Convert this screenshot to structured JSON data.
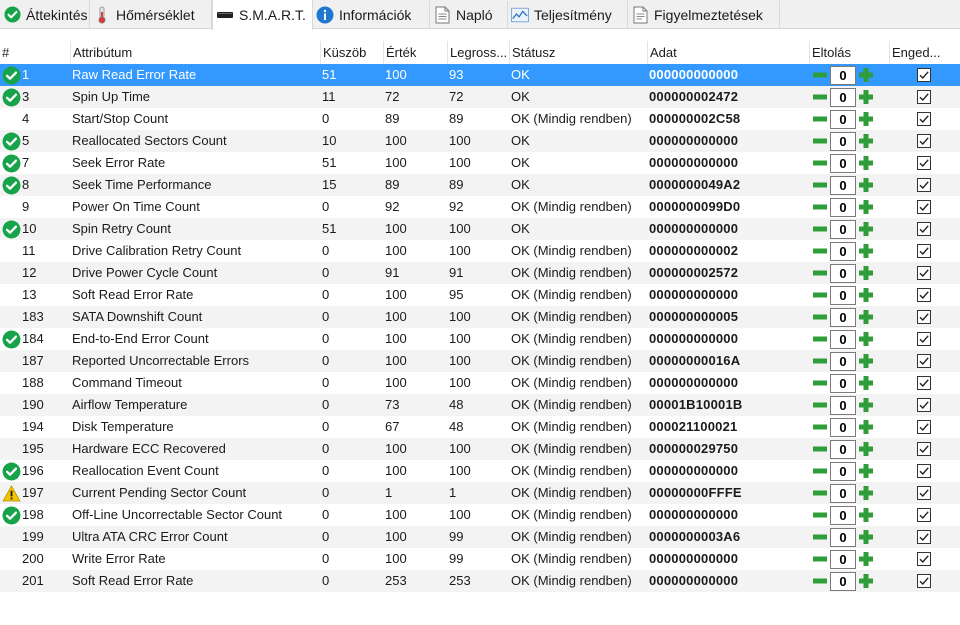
{
  "tabs": [
    {
      "label": "Áttekintés",
      "icon": "ok-icon",
      "active": false
    },
    {
      "label": "Hőmérséklet",
      "icon": "thermometer-icon",
      "active": false
    },
    {
      "label": "S.M.A.R.T.",
      "icon": "drive-icon",
      "active": true
    },
    {
      "label": "Információk",
      "icon": "info-icon",
      "active": false
    },
    {
      "label": "Napló",
      "icon": "log-icon",
      "active": false
    },
    {
      "label": "Teljesítmény",
      "icon": "performance-icon",
      "active": false
    },
    {
      "label": "Figyelmeztetések",
      "icon": "alerts-icon",
      "active": false
    }
  ],
  "columns": {
    "num": "#",
    "attribute": "Attribútum",
    "threshold": "Küszöb",
    "value": "Érték",
    "worst": "Legross...",
    "status": "Státusz",
    "data": "Adat",
    "offset": "Eltolás",
    "enabled": "Enged..."
  },
  "colors": {
    "selection": "#3399ff",
    "ok_green": "#16a34a",
    "warning_yellow": "#f5c400",
    "minus_green": "#2e9d3a",
    "plus_green": "#2e9d3a"
  },
  "rows": [
    {
      "icon": "ok",
      "id": "1",
      "attribute": "Raw Read Error Rate",
      "threshold": "51",
      "value": "100",
      "worst": "93",
      "status": "OK",
      "data": "000000000000",
      "offset": "0",
      "enabled": true,
      "selected": true
    },
    {
      "icon": "ok",
      "id": "3",
      "attribute": "Spin Up Time",
      "threshold": "11",
      "value": "72",
      "worst": "72",
      "status": "OK",
      "data": "000000002472",
      "offset": "0",
      "enabled": true
    },
    {
      "icon": "",
      "id": "4",
      "attribute": "Start/Stop Count",
      "threshold": "0",
      "value": "89",
      "worst": "89",
      "status": "OK (Mindig rendben)",
      "data": "000000002C58",
      "offset": "0",
      "enabled": true
    },
    {
      "icon": "ok",
      "id": "5",
      "attribute": "Reallocated Sectors Count",
      "threshold": "10",
      "value": "100",
      "worst": "100",
      "status": "OK",
      "data": "000000000000",
      "offset": "0",
      "enabled": true
    },
    {
      "icon": "ok",
      "id": "7",
      "attribute": "Seek Error Rate",
      "threshold": "51",
      "value": "100",
      "worst": "100",
      "status": "OK",
      "data": "000000000000",
      "offset": "0",
      "enabled": true
    },
    {
      "icon": "ok",
      "id": "8",
      "attribute": "Seek Time Performance",
      "threshold": "15",
      "value": "89",
      "worst": "89",
      "status": "OK",
      "data": "0000000049A2",
      "offset": "0",
      "enabled": true
    },
    {
      "icon": "",
      "id": "9",
      "attribute": "Power On Time Count",
      "threshold": "0",
      "value": "92",
      "worst": "92",
      "status": "OK (Mindig rendben)",
      "data": "0000000099D0",
      "offset": "0",
      "enabled": true
    },
    {
      "icon": "ok",
      "id": "10",
      "attribute": "Spin Retry Count",
      "threshold": "51",
      "value": "100",
      "worst": "100",
      "status": "OK",
      "data": "000000000000",
      "offset": "0",
      "enabled": true
    },
    {
      "icon": "",
      "id": "11",
      "attribute": "Drive Calibration Retry Count",
      "threshold": "0",
      "value": "100",
      "worst": "100",
      "status": "OK (Mindig rendben)",
      "data": "000000000002",
      "offset": "0",
      "enabled": true
    },
    {
      "icon": "",
      "id": "12",
      "attribute": "Drive Power Cycle Count",
      "threshold": "0",
      "value": "91",
      "worst": "91",
      "status": "OK (Mindig rendben)",
      "data": "000000002572",
      "offset": "0",
      "enabled": true
    },
    {
      "icon": "",
      "id": "13",
      "attribute": "Soft Read Error Rate",
      "threshold": "0",
      "value": "100",
      "worst": "95",
      "status": "OK (Mindig rendben)",
      "data": "000000000000",
      "offset": "0",
      "enabled": true
    },
    {
      "icon": "",
      "id": "183",
      "attribute": "SATA Downshift Count",
      "threshold": "0",
      "value": "100",
      "worst": "100",
      "status": "OK (Mindig rendben)",
      "data": "000000000005",
      "offset": "0",
      "enabled": true
    },
    {
      "icon": "ok",
      "id": "184",
      "attribute": "End-to-End Error Count",
      "threshold": "0",
      "value": "100",
      "worst": "100",
      "status": "OK (Mindig rendben)",
      "data": "000000000000",
      "offset": "0",
      "enabled": true
    },
    {
      "icon": "",
      "id": "187",
      "attribute": "Reported Uncorrectable Errors",
      "threshold": "0",
      "value": "100",
      "worst": "100",
      "status": "OK (Mindig rendben)",
      "data": "00000000016A",
      "offset": "0",
      "enabled": true
    },
    {
      "icon": "",
      "id": "188",
      "attribute": "Command Timeout",
      "threshold": "0",
      "value": "100",
      "worst": "100",
      "status": "OK (Mindig rendben)",
      "data": "000000000000",
      "offset": "0",
      "enabled": true
    },
    {
      "icon": "",
      "id": "190",
      "attribute": "Airflow Temperature",
      "threshold": "0",
      "value": "73",
      "worst": "48",
      "status": "OK (Mindig rendben)",
      "data": "00001B10001B",
      "offset": "0",
      "enabled": true
    },
    {
      "icon": "",
      "id": "194",
      "attribute": "Disk Temperature",
      "threshold": "0",
      "value": "67",
      "worst": "48",
      "status": "OK (Mindig rendben)",
      "data": "000021100021",
      "offset": "0",
      "enabled": true
    },
    {
      "icon": "",
      "id": "195",
      "attribute": "Hardware ECC Recovered",
      "threshold": "0",
      "value": "100",
      "worst": "100",
      "status": "OK (Mindig rendben)",
      "data": "000000029750",
      "offset": "0",
      "enabled": true
    },
    {
      "icon": "ok",
      "id": "196",
      "attribute": "Reallocation Event Count",
      "threshold": "0",
      "value": "100",
      "worst": "100",
      "status": "OK (Mindig rendben)",
      "data": "000000000000",
      "offset": "0",
      "enabled": true
    },
    {
      "icon": "warn",
      "id": "197",
      "attribute": "Current Pending Sector Count",
      "threshold": "0",
      "value": "1",
      "worst": "1",
      "status": "OK (Mindig rendben)",
      "data": "00000000FFFE",
      "offset": "0",
      "enabled": true
    },
    {
      "icon": "ok",
      "id": "198",
      "attribute": "Off-Line Uncorrectable Sector Count",
      "threshold": "0",
      "value": "100",
      "worst": "100",
      "status": "OK (Mindig rendben)",
      "data": "000000000000",
      "offset": "0",
      "enabled": true
    },
    {
      "icon": "",
      "id": "199",
      "attribute": "Ultra ATA CRC Error Count",
      "threshold": "0",
      "value": "100",
      "worst": "99",
      "status": "OK (Mindig rendben)",
      "data": "0000000003A6",
      "offset": "0",
      "enabled": true
    },
    {
      "icon": "",
      "id": "200",
      "attribute": "Write Error Rate",
      "threshold": "0",
      "value": "100",
      "worst": "99",
      "status": "OK (Mindig rendben)",
      "data": "000000000000",
      "offset": "0",
      "enabled": true
    },
    {
      "icon": "",
      "id": "201",
      "attribute": "Soft Read Error Rate",
      "threshold": "0",
      "value": "253",
      "worst": "253",
      "status": "OK (Mindig rendben)",
      "data": "000000000000",
      "offset": "0",
      "enabled": true
    }
  ]
}
